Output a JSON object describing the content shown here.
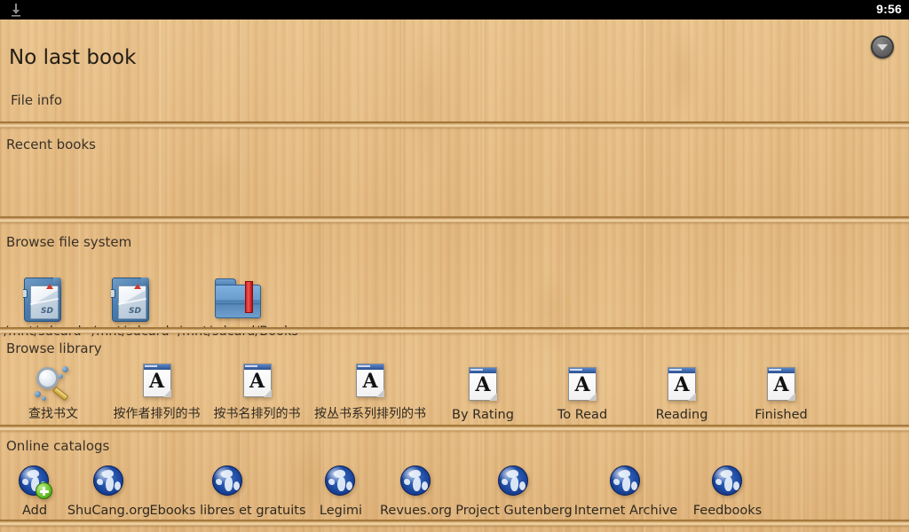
{
  "statusbar": {
    "clock": "9:56",
    "download_icon": "download-icon"
  },
  "header": {
    "title": "No last book",
    "file_info_label": "File info",
    "expand_button_icon": "chevron-down-circle-icon"
  },
  "sections": {
    "recent_books": {
      "title": "Recent books",
      "items": []
    },
    "browse_file_system": {
      "title": "Browse file system",
      "items": [
        {
          "label": "/mnt/sdcard",
          "icon": "sdcard-icon"
        },
        {
          "label": "/mnt/sdcard",
          "icon": "sdcard-icon"
        },
        {
          "label": "/mnt/sdcard/Books",
          "icon": "folder-bookmark-icon"
        }
      ]
    },
    "browse_library": {
      "title": "Browse library",
      "items": [
        {
          "label": "查找书文",
          "icon": "search-magnifier-icon"
        },
        {
          "label": "按作者排列的书",
          "icon": "document-a-icon"
        },
        {
          "label": "按书名排列的书",
          "icon": "document-a-icon"
        },
        {
          "label": "按丛书系列排列的书",
          "icon": "document-a-icon"
        },
        {
          "label": "By Rating",
          "icon": "document-a-icon"
        },
        {
          "label": "To Read",
          "icon": "document-a-icon"
        },
        {
          "label": "Reading",
          "icon": "document-a-icon"
        },
        {
          "label": "Finished",
          "icon": "document-a-icon"
        }
      ]
    },
    "online_catalogs": {
      "title": "Online catalogs",
      "items": [
        {
          "label": "Add",
          "icon": "globe-add-icon"
        },
        {
          "label": "ShuCang.org",
          "icon": "globe-icon"
        },
        {
          "label": "Ebooks libres et gratuits",
          "icon": "globe-icon"
        },
        {
          "label": "Legimi",
          "icon": "globe-icon"
        },
        {
          "label": "Revues.org",
          "icon": "globe-icon"
        },
        {
          "label": "Project Gutenberg",
          "icon": "globe-icon"
        },
        {
          "label": "Internet Archive",
          "icon": "globe-icon"
        },
        {
          "label": "Feedbooks",
          "icon": "globe-icon"
        }
      ]
    }
  },
  "colors": {
    "wood": "#e3b87f",
    "statusbar": "#000000",
    "text": "#2f2921",
    "folder_blue": "#5d8fc4",
    "bookmark_red": "#cf1f1f",
    "globe_blue": "#1d49a0",
    "add_green": "#6dc22c"
  }
}
